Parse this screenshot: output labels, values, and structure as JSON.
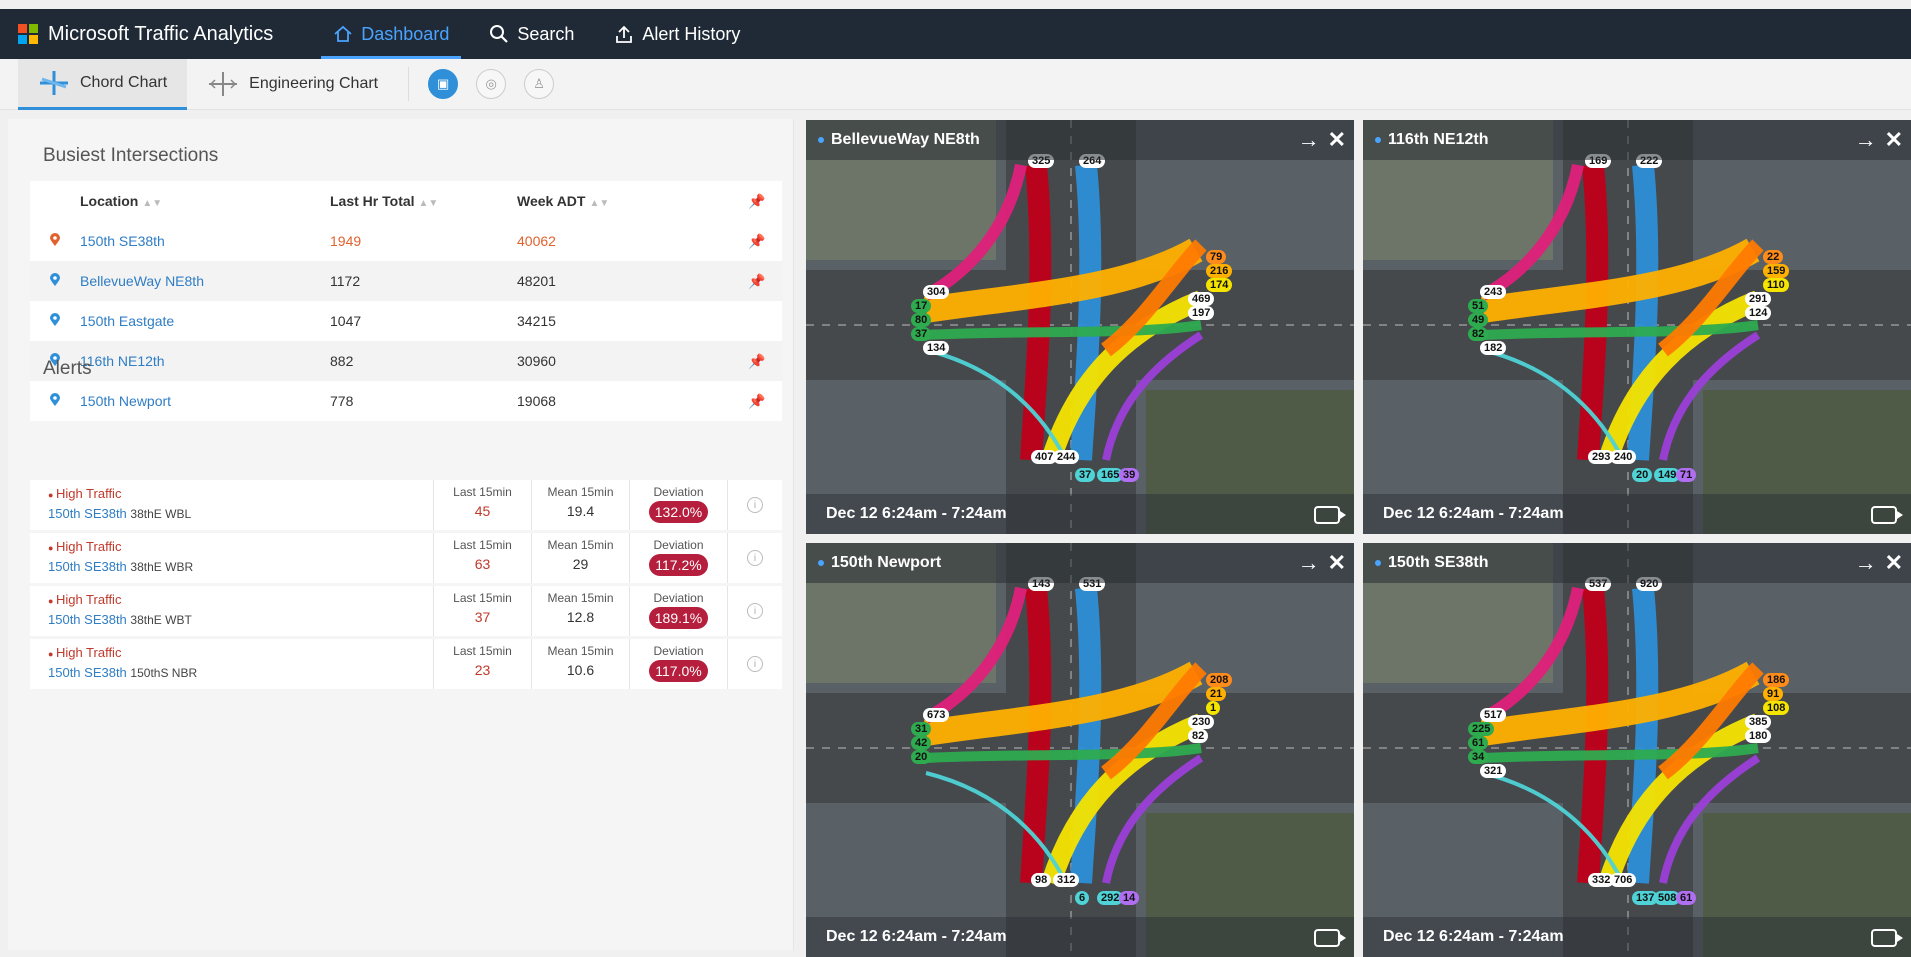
{
  "app": {
    "title": "Microsoft Traffic Analytics"
  },
  "nav": [
    {
      "label": "Dashboard",
      "icon": "home-icon",
      "active": true
    },
    {
      "label": "Search",
      "icon": "search-icon",
      "active": false
    },
    {
      "label": "Alert History",
      "icon": "upload-icon",
      "active": false
    }
  ],
  "subtabs": [
    {
      "label": "Chord Chart",
      "icon": "chord-chart-icon",
      "active": true
    },
    {
      "label": "Engineering Chart",
      "icon": "engineering-chart-icon",
      "active": false
    }
  ],
  "modes": [
    "car-icon",
    "bike-icon",
    "pedestrian-icon"
  ],
  "busiest": {
    "title": "Busiest Intersections",
    "columns": {
      "location": "Location",
      "last_hr": "Last Hr Total",
      "week_adt": "Week ADT"
    },
    "rows": [
      {
        "location": "150th SE38th",
        "last_hr": "1949",
        "week_adt": "40062",
        "hot": true,
        "pinned": true
      },
      {
        "location": "BellevueWay NE8th",
        "last_hr": "1172",
        "week_adt": "48201",
        "hot": false,
        "pinned": true
      },
      {
        "location": "150th Eastgate",
        "last_hr": "1047",
        "week_adt": "34215",
        "hot": false,
        "pinned": false
      },
      {
        "location": "116th NE12th",
        "last_hr": "882",
        "week_adt": "30960",
        "hot": false,
        "pinned": true
      },
      {
        "location": "150th Newport",
        "last_hr": "778",
        "week_adt": "19068",
        "hot": false,
        "pinned": true
      }
    ]
  },
  "alerts": {
    "title": "Alerts",
    "labels": {
      "last15": "Last 15min",
      "mean15": "Mean 15min",
      "deviation": "Deviation"
    },
    "rows": [
      {
        "type": "High Traffic",
        "location": "150th SE38th",
        "approach": "38thE WBL",
        "last15": "45",
        "mean15": "19.4",
        "deviation": "132.0%"
      },
      {
        "type": "High Traffic",
        "location": "150th SE38th",
        "approach": "38thE WBR",
        "last15": "63",
        "mean15": "29",
        "deviation": "117.2%"
      },
      {
        "type": "High Traffic",
        "location": "150th SE38th",
        "approach": "38thE WBT",
        "last15": "37",
        "mean15": "12.8",
        "deviation": "189.1%"
      },
      {
        "type": "High Traffic",
        "location": "150th SE38th",
        "approach": "150thS NBR",
        "last15": "23",
        "mean15": "10.6",
        "deviation": "117.0%"
      }
    ]
  },
  "tiles": [
    {
      "title": "BellevueWay NE8th",
      "time": "Dec 12 6:24am - 7:24am",
      "labels": {
        "n": [
          "325",
          "264"
        ],
        "e": [
          "79",
          "216",
          "174",
          "469",
          "197"
        ],
        "s": [
          "407",
          "244",
          "37",
          "165",
          "39"
        ],
        "w": [
          "304",
          "17",
          "80",
          "37",
          "134"
        ]
      }
    },
    {
      "title": "116th NE12th",
      "time": "Dec 12 6:24am - 7:24am",
      "labels": {
        "n": [
          "169",
          "222"
        ],
        "e": [
          "22",
          "159",
          "110",
          "291",
          "124"
        ],
        "s": [
          "293",
          "240",
          "20",
          "149",
          "71"
        ],
        "w": [
          "243",
          "51",
          "49",
          "82",
          "182"
        ]
      }
    },
    {
      "title": "150th Newport",
      "time": "Dec 12 6:24am - 7:24am",
      "labels": {
        "n": [
          "143",
          "531"
        ],
        "e": [
          "208",
          "21",
          "1",
          "230",
          "82"
        ],
        "s": [
          "98",
          "312",
          "6",
          "292",
          "14"
        ],
        "w": [
          "673",
          "31",
          "42",
          "20"
        ]
      }
    },
    {
      "title": "150th SE38th",
      "time": "Dec 12 6:24am - 7:24am",
      "labels": {
        "n": [
          "537",
          "920"
        ],
        "e": [
          "186",
          "91",
          "108",
          "385",
          "180"
        ],
        "s": [
          "332",
          "706",
          "137",
          "508",
          "61"
        ],
        "w": [
          "517",
          "225",
          "61",
          "34",
          "321"
        ]
      }
    }
  ],
  "colors": {
    "accent": "#2f8fd8",
    "nav_bg": "#1f2a36",
    "alert_red": "#b51e3c",
    "hot": "#e0622d"
  }
}
